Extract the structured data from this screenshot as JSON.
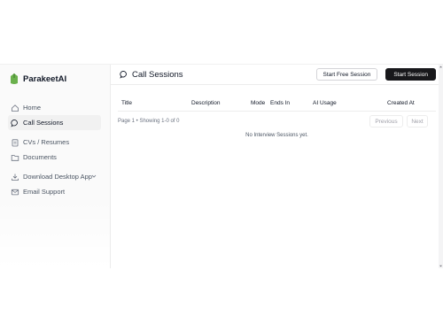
{
  "brand": {
    "name": "ParakeetAI",
    "color": "#6ab04c"
  },
  "sidebar": {
    "items": [
      {
        "label": "Home",
        "icon": "home-icon"
      },
      {
        "label": "Call Sessions",
        "icon": "chat-bubble-icon",
        "active": true
      },
      {
        "label": "CVs / Resumes",
        "icon": "clipboard-icon"
      },
      {
        "label": "Documents",
        "icon": "folder-icon"
      },
      {
        "label": "Download Desktop App",
        "icon": "download-icon",
        "has_chevron": true
      },
      {
        "label": "Email Support",
        "icon": "mail-icon"
      }
    ]
  },
  "header": {
    "title": "Call Sessions",
    "title_icon": "chat-bubble-icon",
    "start_free_label": "Start Free Session",
    "start_label": "Start Session"
  },
  "table": {
    "columns": [
      "Title",
      "Description",
      "Mode",
      "Ends In",
      "AI Usage",
      "Created At"
    ],
    "rows": []
  },
  "pagination": {
    "info": "Page 1 • Showing 1-0 of 0",
    "previous": "Previous",
    "next": "Next"
  },
  "empty_message": "No Interview Sessions yet.",
  "colors": {
    "primary_button": "#18181b",
    "sidebar_bg": "#fafafa"
  }
}
